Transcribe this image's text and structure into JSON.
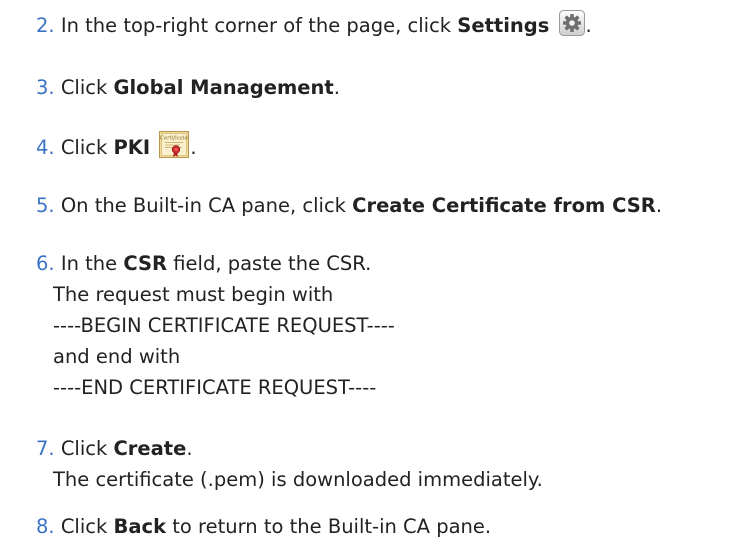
{
  "steps": [
    {
      "number": "2.",
      "parts": [
        "In the top-right corner of the page, click ",
        "Settings",
        "."
      ],
      "icon": "gear-icon"
    },
    {
      "number": "3.",
      "parts": [
        "Click ",
        "Global Management",
        "."
      ]
    },
    {
      "number": "4.",
      "parts": [
        "Click ",
        "PKI",
        "."
      ],
      "icon": "certificate-icon",
      "icon_text": "Certificate"
    },
    {
      "number": "5.",
      "parts": [
        "On the Built-in CA pane, click ",
        "Create Certificate from CSR",
        "."
      ]
    },
    {
      "number": "6.",
      "parts": [
        "In the ",
        "CSR",
        " field, paste the CSR."
      ],
      "lines": [
        "The request must begin with",
        "----BEGIN CERTIFICATE REQUEST----",
        "and end with",
        "----END CERTIFICATE REQUEST----"
      ]
    },
    {
      "number": "7.",
      "parts": [
        "Click ",
        "Create",
        "."
      ],
      "lines": [
        "The certificate (.pem) is downloaded immediately."
      ]
    },
    {
      "number": "8.",
      "parts": [
        "Click ",
        "Back",
        " to return to the Built-in CA pane."
      ]
    }
  ],
  "colors": {
    "step_number": "#3b73c4",
    "text": "#222222",
    "background": "#ffffff"
  }
}
